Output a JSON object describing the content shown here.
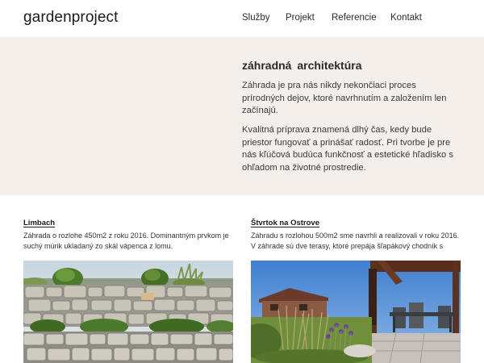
{
  "header": {
    "logo": "gardenproject",
    "nav": [
      "Služby",
      "Projekt",
      "Referencie",
      "Kontakt"
    ]
  },
  "hero": {
    "title": "záhradná architektúra",
    "paragraphs": [
      "Záhrada je pra nás nikdy nekončiaci proces prírodných dejov, ktoré navrhnutím a založením len začínajú.",
      "Kvalitná príprava znamená dlhý čas, kedy bude priestor fungovať a prinášať radosť. Pri tvorbe je pre nás kľúčová budúca funkčnosť a estetické hľadisko s ohľadom na životné prostredie."
    ]
  },
  "projects": [
    {
      "title": "Limbach",
      "description": "Záhrada o rozlohe 450m2 z roku 2016. Dominantným prvkom je suchý múrik ukladaný zo skál vápenca z lomu."
    },
    {
      "title": "Štvrtok na Ostrove",
      "description": "Záhradu s rozlohou 500m2 sme navrhli a realizovali v roku 2016. V záhrade sú dve terasy, ktoré prepája šľapákový chodník s kamennými prvkami."
    }
  ],
  "colors": {
    "hero_bg": "#f4efea",
    "text": "#2b2b2b",
    "header_bg": "#ffffff"
  }
}
